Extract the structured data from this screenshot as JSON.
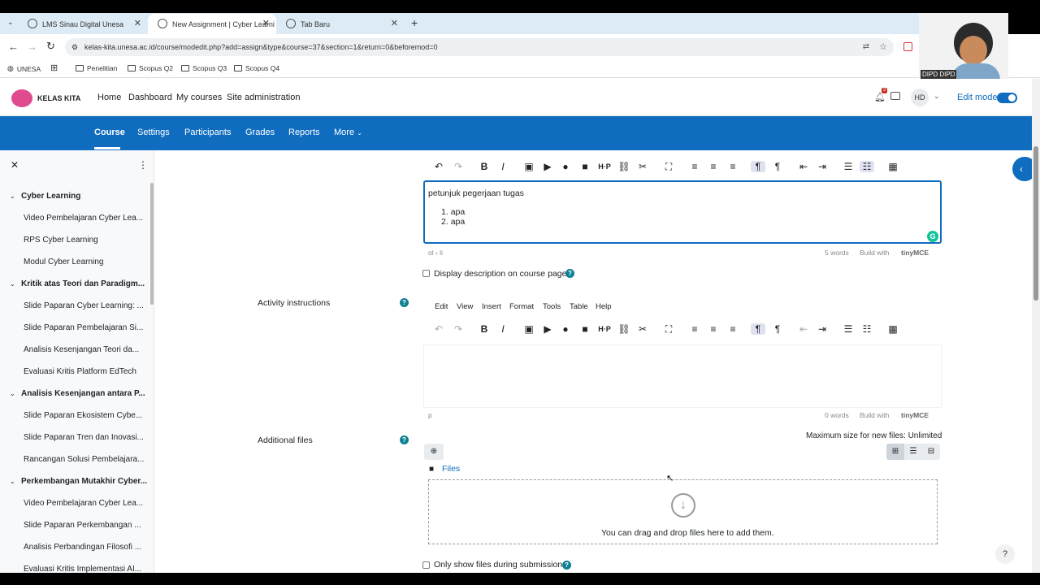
{
  "browser": {
    "tabs": [
      {
        "title": "LMS Sinau Digital Unesa"
      },
      {
        "title": "New Assignment | Cyber Learni"
      },
      {
        "title": "Tab Baru"
      }
    ],
    "url": "kelas-kita.unesa.ac.id/course/modedit.php?add=assign&type&course=37&section=1&return=0&beforemod=0",
    "bookmarks": [
      "UNESA",
      "Penelitian",
      "Scopus Q2",
      "Scopus Q3",
      "Scopus Q4"
    ],
    "avatar_label": "DIPD DIPD"
  },
  "site": {
    "logo_text": "KELAS KITA",
    "nav": [
      "Home",
      "Dashboard",
      "My courses",
      "Site administration"
    ],
    "notif_count": "3",
    "user_initials": "HD",
    "edit_mode_label": "Edit mode"
  },
  "secondary_nav": [
    "Course",
    "Settings",
    "Participants",
    "Grades",
    "Reports",
    "More"
  ],
  "sidebar": {
    "sections": [
      {
        "title": "Cyber Learning",
        "items": [
          "Video Pembelajaran Cyber Lea...",
          "RPS Cyber Learning",
          "Modul Cyber Learning"
        ]
      },
      {
        "title": "Kritik atas Teori dan Paradigm...",
        "items": [
          "Slide Paparan Cyber Learning: ...",
          "Slide Paparan Pembelajaran Si...",
          "Analisis Kesenjangan Teori da...",
          "Evaluasi Kritis Platform EdTech"
        ]
      },
      {
        "title": "Analisis Kesenjangan antara P...",
        "items": [
          "Slide Paparan Ekosistem Cybe...",
          "Slide Paparan Tren dan Inovasi...",
          "Rancangan Solusi Pembelajara..."
        ]
      },
      {
        "title": "Perkembangan Mutakhir Cyber...",
        "items": [
          "Video Pembelajaran Cyber Lea...",
          "Slide Paparan Perkembangan ...",
          "Analisis Perbandingan Filosofi ...",
          "Evaluasi Kritis Implementasi AI..."
        ]
      }
    ]
  },
  "description_editor": {
    "heading": "petunjuk pegerjaan tugas",
    "list": [
      "apa",
      "apa"
    ],
    "path": "ol › li",
    "word_count": "5 words",
    "built_with": "Build with",
    "brand": "tinyMCE"
  },
  "display_description_label": "Display description on course page",
  "activity_instructions": {
    "label": "Activity instructions",
    "menus": [
      "Edit",
      "View",
      "Insert",
      "Format",
      "Tools",
      "Table",
      "Help"
    ],
    "path": "p",
    "word_count": "0 words",
    "built_with": "Build with",
    "brand": "tinyMCE"
  },
  "additional_files": {
    "label": "Additional files",
    "max_size": "Maximum size for new files: Unlimited",
    "folder": "Files",
    "drop_text": "You can drag and drop files here to add them."
  },
  "only_show_label": "Only show files during submission",
  "help_button": "?"
}
